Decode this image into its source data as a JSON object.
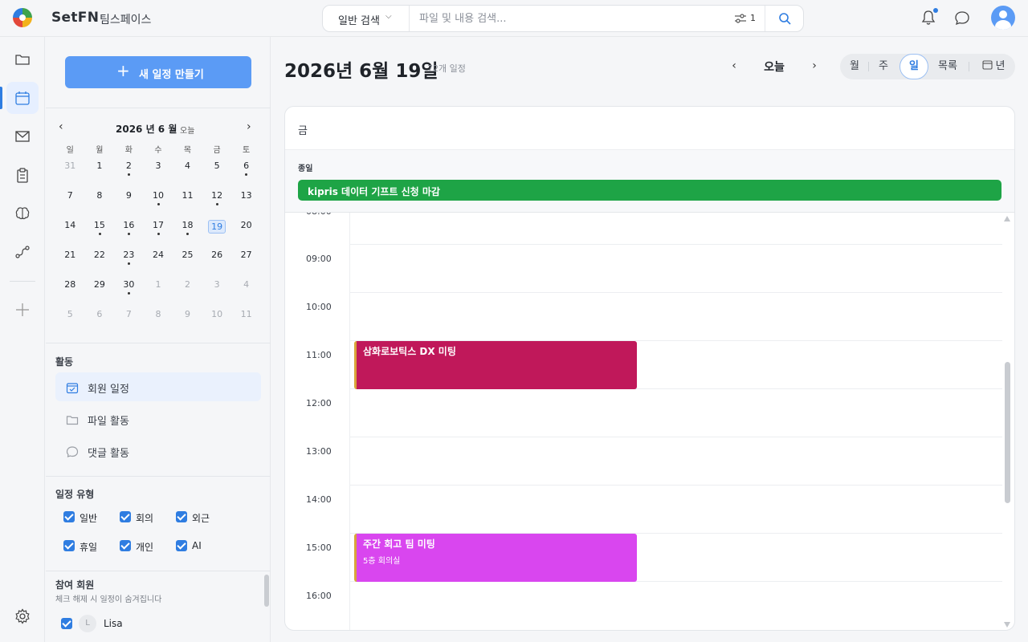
{
  "topbar": {
    "app_name": "SetFN",
    "workspace": "팀스페이스",
    "search_type": "일반 검색",
    "search_placeholder": "파일 및 내용 검색...",
    "filter_count": "1"
  },
  "mini_calendar": {
    "title": "2026 년 6 월",
    "today_label": "오늘",
    "weekdays": [
      "일",
      "월",
      "화",
      "수",
      "목",
      "금",
      "토"
    ],
    "weeks": [
      [
        "31",
        "1",
        "2",
        "3",
        "4",
        "5",
        "6"
      ],
      [
        "7",
        "8",
        "9",
        "10",
        "11",
        "12",
        "13"
      ],
      [
        "14",
        "15",
        "16",
        "17",
        "18",
        "19",
        "20"
      ],
      [
        "21",
        "22",
        "23",
        "24",
        "25",
        "26",
        "27"
      ],
      [
        "28",
        "29",
        "30",
        "1",
        "2",
        "3",
        "4"
      ],
      [
        "5",
        "6",
        "7",
        "8",
        "9",
        "10",
        "11"
      ]
    ]
  },
  "sidebar": {
    "new_button": "새 일정 만들기",
    "activity_title": "활동",
    "activity_items": [
      "회원 일정",
      "파일 활동",
      "댓글 활동"
    ],
    "type_title": "일정 유형",
    "types": [
      "일반",
      "회의",
      "외근",
      "휴일",
      "개인",
      "AI"
    ],
    "members_title": "참여 회원",
    "members_hint": "체크 해제 시 일정이 숨겨집니다",
    "member_initial": "L",
    "member_name": "Lisa"
  },
  "main": {
    "title": "2026년 6월 19일",
    "count": "72개 일정",
    "today_button": "오늘",
    "views": [
      "월",
      "주",
      "일",
      "목록",
      "년"
    ],
    "active_view": "일",
    "day_label": "금",
    "allday_label": "종일",
    "allday_event": "kipris 데이터 기프트 신청 마감",
    "hours": [
      "09:00",
      "10:00",
      "11:00",
      "12:00",
      "13:00",
      "14:00",
      "15:00",
      "16:00"
    ],
    "events": [
      {
        "title": "삼화로보틱스 DX 미팅",
        "location": "",
        "color": "#c0185a"
      },
      {
        "title": "주간 회고 팀 미팅",
        "location": "5층 회의실",
        "color": "#d946ef"
      }
    ]
  },
  "colors": {
    "accent": "#2f7de1",
    "button": "#5b9bf5",
    "allday_event": "#1ea446"
  }
}
